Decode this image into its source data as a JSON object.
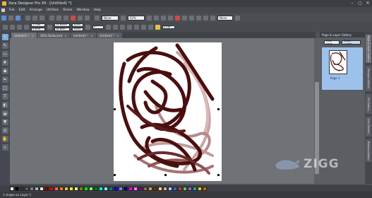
{
  "window": {
    "title": "Xara Designer Pro X9 - [Untitled1 *]"
  },
  "menu": [
    "File",
    "Edit",
    "Arrange",
    "Utilities",
    "Share",
    "Window",
    "Help"
  ],
  "toolbar": {
    "zoom_value": "None",
    "zoom_percent": "63%",
    "quality": "None"
  },
  "infobar": {
    "x": "1.7cm",
    "y": "0.8cm",
    "w": "15.65cm",
    "h": "16.8cm",
    "w_pct": "100%",
    "h_pct": "100%",
    "angle": "0°",
    "line_w": "0.5pt"
  },
  "tabs": [
    {
      "label": "Untitled1 *"
    },
    {
      "label": "ZIGG Ballooned"
    },
    {
      "label": "Untitled2 *"
    },
    {
      "label": "Untitled3 *"
    }
  ],
  "gallery": {
    "title": "Page & Layer Gallery",
    "btn_new_page": "New page",
    "btn_layers": "Show Layers",
    "page_caption": "Page 1"
  },
  "right_tabs": [
    "Page & Layer Gallery",
    "Designs Gallery",
    "Fill Gallery",
    "Line Gallery",
    "Bitmap Gallery"
  ],
  "status": {
    "text": "1 shape on Layer 1"
  },
  "watermark": {
    "text": "ZIGG"
  },
  "palette": [
    "#ffffff",
    "#000000",
    "#333333",
    "#5a5a5a",
    "#808080",
    "#b3b3b3",
    "#e6e6e6",
    "#800000",
    "#ff0000",
    "#ff6666",
    "#ff8000",
    "#ffb366",
    "#ffff00",
    "#ffff99",
    "#808000",
    "#00ff00",
    "#80ff80",
    "#008000",
    "#00ffff",
    "#80ffff",
    "#008080",
    "#0000ff",
    "#8080ff",
    "#000080",
    "#ff00ff",
    "#ff80ff",
    "#800080",
    "#996633",
    "#cc9966",
    "#663300",
    "#ffcc99",
    "#ff9999",
    "#99ccff",
    "#3366cc",
    "#cc3366",
    "#66cc33",
    "#9966cc",
    "#339999",
    "#cccc33",
    "#cc6600"
  ],
  "colors": {
    "accent": "#5a8fd0",
    "stroke": "#4a0e0e"
  }
}
